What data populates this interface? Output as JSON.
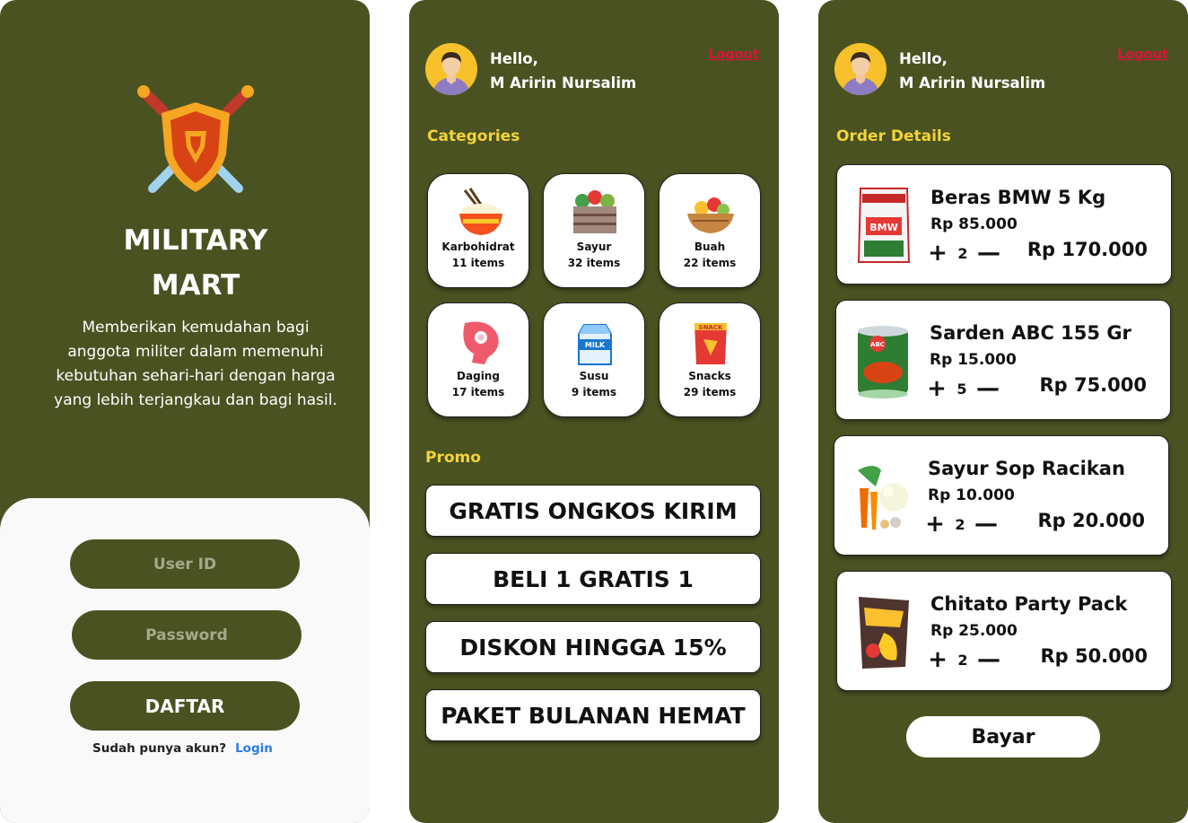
{
  "login": {
    "brand_line1": "MILITARY",
    "brand_line2": "MART",
    "tagline": "Memberikan kemudahan bagi anggota militer dalam memenuhi kebutuhan sehari-hari dengan harga yang lebih terjangkau dan bagi hasil.",
    "userid_placeholder": "User ID",
    "password_placeholder": "Password",
    "daftar_label": "DAFTAR",
    "have_account": "Sudah punya akun?",
    "login_link": "Login"
  },
  "header": {
    "hello": "Hello,",
    "user_name": "M Aririn Nursalim",
    "logout": "Logout"
  },
  "home": {
    "categories_title": "Categories",
    "categories": [
      {
        "name": "Karbohidrat",
        "count": "11 items",
        "icon": "rice-bowl-icon"
      },
      {
        "name": "Sayur",
        "count": "32 items",
        "icon": "vegetable-crate-icon"
      },
      {
        "name": "Buah",
        "count": "22 items",
        "icon": "fruit-basket-icon"
      },
      {
        "name": "Daging",
        "count": "17 items",
        "icon": "meat-icon"
      },
      {
        "name": "Susu",
        "count": "9 items",
        "icon": "milk-carton-icon"
      },
      {
        "name": "Snacks",
        "count": "29 items",
        "icon": "snack-bag-icon"
      }
    ],
    "promo_title": "Promo",
    "promos": [
      "GRATIS ONGKOS KIRIM",
      "BELI 1 GRATIS 1",
      "DISKON HINGGA 15%",
      "PAKET BULANAN HEMAT"
    ]
  },
  "order": {
    "title": "Order Details",
    "items": [
      {
        "name": "Beras BMW 5 Kg",
        "price": "Rp 85.000",
        "qty": "2",
        "total": "Rp 170.000"
      },
      {
        "name": "Sarden ABC 155 Gr",
        "price": "Rp 15.000",
        "qty": "5",
        "total": "Rp 75.000"
      },
      {
        "name": "Sayur Sop Racikan",
        "price": "Rp 10.000",
        "qty": "2",
        "total": "Rp 20.000"
      },
      {
        "name": "Chitato Party Pack",
        "price": "Rp 25.000",
        "qty": "2",
        "total": "Rp 50.000"
      }
    ],
    "plus": "+",
    "minus": "—",
    "pay_label": "Bayar"
  },
  "colors": {
    "panel": "#4a5221",
    "accent_yellow": "#f2d33b",
    "logout_red": "#e0133a",
    "link_blue": "#2b7be6"
  }
}
